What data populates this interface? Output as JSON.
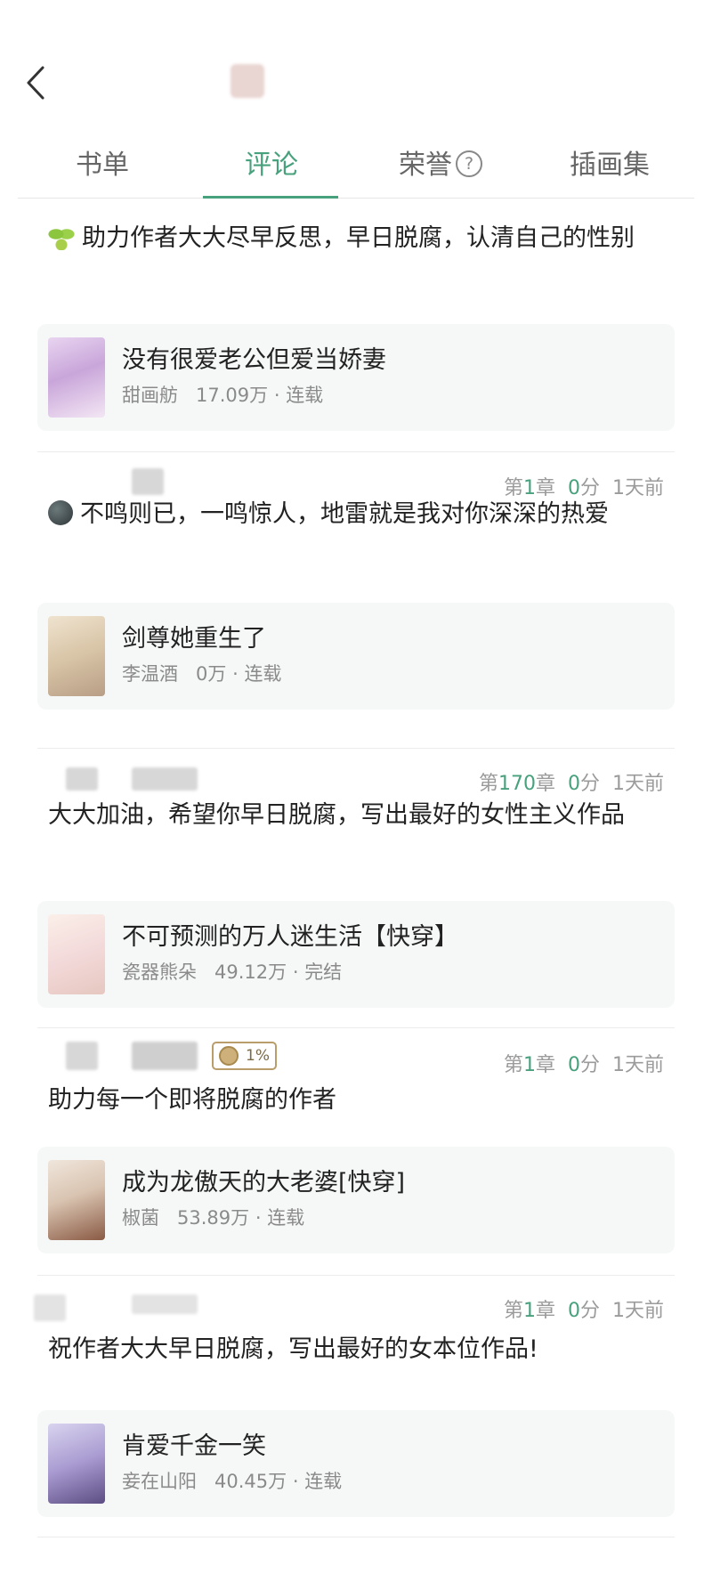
{
  "tabs": [
    {
      "label": "书单"
    },
    {
      "label": "评论"
    },
    {
      "label": "荣誉"
    },
    {
      "label": "插画集"
    }
  ],
  "active_tab": "评论",
  "help_icon_glyph": "?",
  "comments": [
    {
      "meta": null,
      "emoji": "sprout-icon",
      "text": "助力作者大大尽早反思，早日脱腐，认清自己的性别",
      "book": {
        "title": "没有很爱老公但爱当娇妻",
        "author": "甜画舫",
        "words": "17.09万",
        "status": "连载"
      }
    },
    {
      "meta": {
        "chapter_prefix": "第",
        "chapter_num": "1",
        "chapter_suffix": "章",
        "score_num": "0",
        "score_suffix": "分",
        "time": "1天前"
      },
      "emoji": "bomb-icon",
      "text": "不鸣则已，一鸣惊人，地雷就是我对你深深的热爱",
      "book": {
        "title": "剑尊她重生了",
        "author": "李温酒",
        "words": "0万",
        "status": "连载"
      }
    },
    {
      "meta": {
        "chapter_prefix": "第",
        "chapter_num": "170",
        "chapter_suffix": "章",
        "score_num": "0",
        "score_suffix": "分",
        "time": "1天前"
      },
      "emoji": null,
      "text": "大大加油，希望你早日脱腐，写出最好的女性主义作品",
      "book": {
        "title": "不可预测的万人迷生活【快穿】",
        "author": "瓷器熊朵",
        "words": "49.12万",
        "status": "完结"
      }
    },
    {
      "meta": {
        "chapter_prefix": "第",
        "chapter_num": "1",
        "chapter_suffix": "章",
        "score_num": "0",
        "score_suffix": "分",
        "time": "1天前",
        "badge": "1%"
      },
      "emoji": null,
      "text": "助力每一个即将脱腐的作者",
      "book": {
        "title": "成为龙傲天的大老婆[快穿]",
        "author": "椒菌",
        "words": "53.89万",
        "status": "连载"
      }
    },
    {
      "meta": {
        "chapter_prefix": "第",
        "chapter_num": "1",
        "chapter_suffix": "章",
        "score_num": "0",
        "score_suffix": "分",
        "time": "1天前"
      },
      "emoji": null,
      "text": "祝作者大大早日脱腐，写出最好的女本位作品!",
      "book": {
        "title": "肯爱千金一笑",
        "author": "妾在山阳",
        "words": "40.45万",
        "status": "连载"
      }
    }
  ],
  "colors": {
    "accent": "#48a17d",
    "muted": "#9b9b9b",
    "card_bg": "#f6f8f7"
  }
}
